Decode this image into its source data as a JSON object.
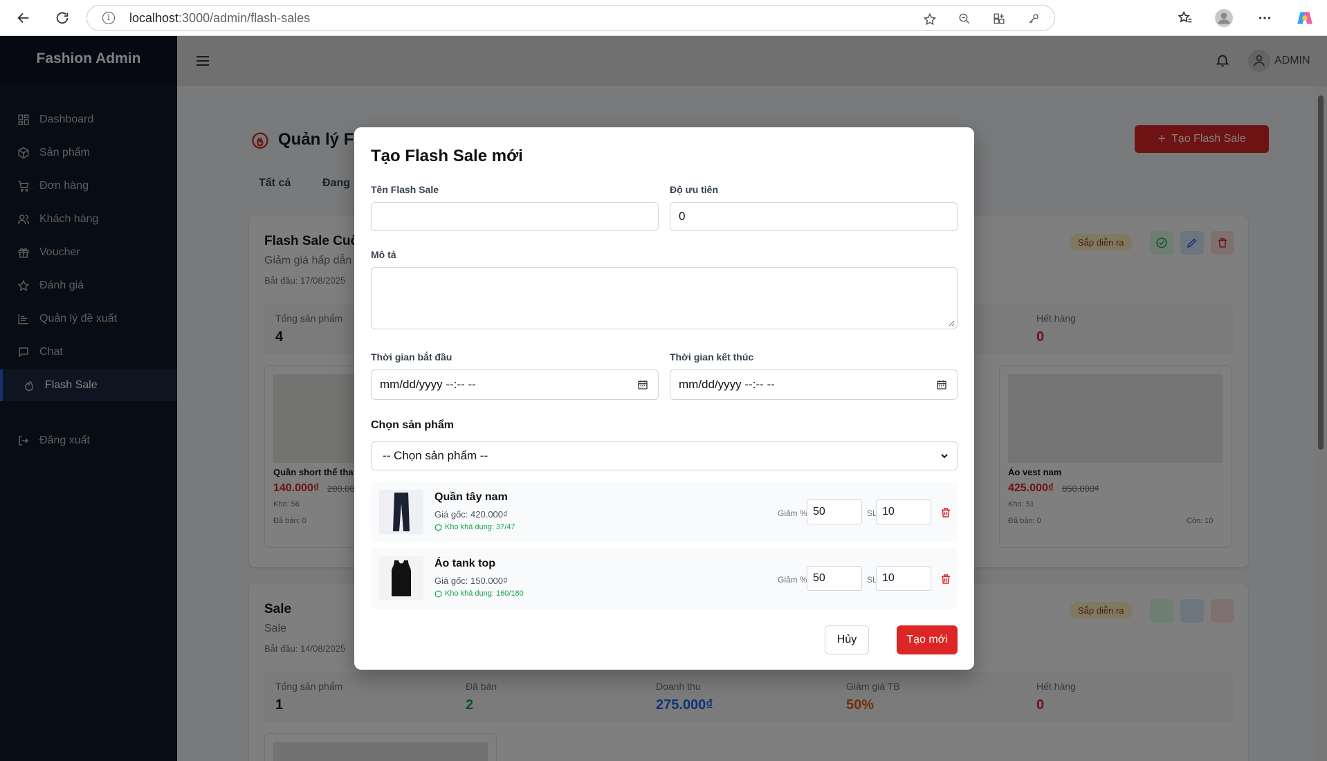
{
  "browser": {
    "url_host": "localhost",
    "url_path": ":3000/admin/flash-sales"
  },
  "sidebar": {
    "brand": "Fashion Admin",
    "items": [
      {
        "label": "Dashboard",
        "icon": "grid-icon"
      },
      {
        "label": "Sản phẩm",
        "icon": "box-icon"
      },
      {
        "label": "Đơn hàng",
        "icon": "cart-icon"
      },
      {
        "label": "Khách hàng",
        "icon": "users-icon"
      },
      {
        "label": "Voucher",
        "icon": "gift-icon"
      },
      {
        "label": "Đánh giá",
        "icon": "star-icon"
      },
      {
        "label": "Quản lý đề xuất",
        "icon": "chart-icon"
      },
      {
        "label": "Chat",
        "icon": "chat-icon"
      },
      {
        "label": "Flash Sale",
        "icon": "flame-icon",
        "active": true
      }
    ],
    "logout": "Đăng xuất"
  },
  "header": {
    "user": "ADMIN"
  },
  "page": {
    "title": "Quản lý Fl",
    "create_button": "Tạo Flash Sale",
    "tabs": [
      "Tất cả",
      "Đang"
    ],
    "sales": [
      {
        "name": "Flash Sale Cuố",
        "desc": "Giảm giá hấp dẫn",
        "start": "Bắt đầu: 17/08/2025",
        "status": "Sắp diễn ra",
        "stats": [
          {
            "label": "Tổng sản phẩm",
            "value": "4"
          },
          {
            "label": "Hết hàng",
            "value": "0"
          }
        ],
        "products": [
          {
            "name": "Quần short thể tha",
            "price": "140.000₫",
            "old": "200.00",
            "stock": "Kho: 56",
            "sold": "Đã bán: 0"
          },
          {
            "name": "Áo vest nam",
            "price": "425.000₫",
            "old": "850.000₫",
            "stock": "Kho: 51",
            "sold": "Đã bán: 0",
            "left": "Còn: 10"
          }
        ]
      },
      {
        "name": "Sale",
        "desc": "Sale",
        "start": "Bắt đầu: 14/08/2025",
        "status": "Sắp diễn ra",
        "stats": [
          {
            "label": "Tổng sản phẩm",
            "value": "1"
          },
          {
            "label": "Đã bán",
            "value": "2"
          },
          {
            "label": "Doanh thu",
            "value": "275.000₫"
          },
          {
            "label": "Giảm giá TB",
            "value": "50%"
          },
          {
            "label": "Hết hàng",
            "value": "0"
          }
        ]
      }
    ]
  },
  "modal": {
    "title": "Tạo Flash Sale mới",
    "name_label": "Tên Flash Sale",
    "name_value": "",
    "priority_label": "Độ ưu tiên",
    "priority_value": "0",
    "desc_label": "Mô tả",
    "start_label": "Thời gian bắt đầu",
    "end_label": "Thời gian kết thúc",
    "datetime_placeholder": "mm/dd/yyyy --:-- --",
    "product_label": "Chọn sản phẩm",
    "product_select": "-- Chọn sản phẩm --",
    "discount_label": "Giảm %",
    "qty_label": "SL",
    "items": [
      {
        "name": "Quần tây nam",
        "price": "Giá gốc: 420.000₫",
        "stock": "Kho khả dụng: 37/47",
        "discount": "50",
        "qty": "10"
      },
      {
        "name": "Áo tank top",
        "price": "Giá gốc: 150.000₫",
        "stock": "Kho khả dụng: 160/180",
        "discount": "50",
        "qty": "10"
      }
    ],
    "cancel": "Hủy",
    "submit": "Tạo mới"
  }
}
